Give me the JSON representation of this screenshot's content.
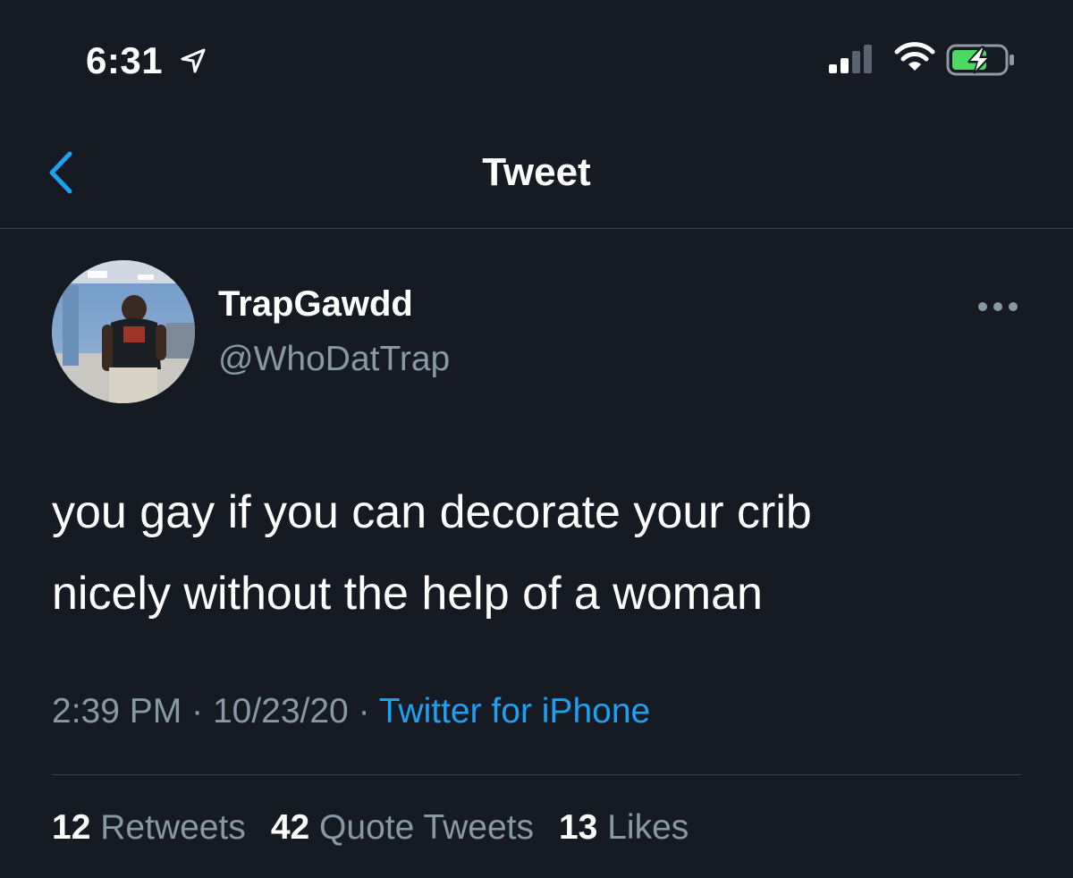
{
  "status_bar": {
    "time": "6:31",
    "icons": [
      "location-arrow-icon",
      "cellular-signal-icon",
      "wifi-icon",
      "battery-charging-icon"
    ]
  },
  "header": {
    "title": "Tweet",
    "back_icon": "chevron-left-icon"
  },
  "tweet": {
    "author": {
      "display_name": "TrapGawdd",
      "handle": "@WhoDatTrap"
    },
    "text_lines": [
      "you gay if you can decorate your crib",
      "nicely without the help of a woman"
    ],
    "time": "2:39 PM",
    "date": "10/23/20",
    "separator": "·",
    "source": "Twitter for iPhone",
    "stats": {
      "retweets_count": "12",
      "retweets_label": "Retweets",
      "quote_tweets_count": "42",
      "quote_tweets_label": "Quote Tweets",
      "likes_count": "13",
      "likes_label": "Likes"
    }
  },
  "colors": {
    "background": "#151a23",
    "text_primary": "#ffffff",
    "text_secondary": "#8899a6",
    "accent": "#1da1f2",
    "divider": "#38444d",
    "battery_charge": "#4cd964"
  }
}
